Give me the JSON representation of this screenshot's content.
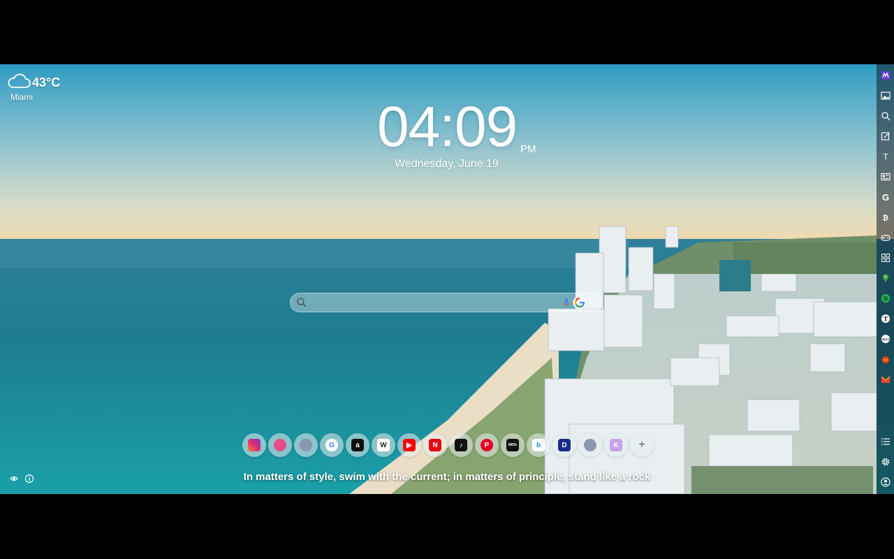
{
  "weather": {
    "temperature": "43°C",
    "city": "Miami",
    "icon": "cloud-icon"
  },
  "clock": {
    "time": "04:09",
    "ampm": "PM",
    "date": "Wednesday, June 19"
  },
  "search": {
    "placeholder": "",
    "engine_icon": "google-icon"
  },
  "quote": {
    "text": "In matters of style, swim with the current; in matters of principle, stand like a rock"
  },
  "dock": {
    "shortcuts": [
      {
        "name": "instagram",
        "label": "",
        "color": "#e1306c"
      },
      {
        "name": "dribbble",
        "label": "",
        "color": "#ea4c89"
      },
      {
        "name": "web",
        "label": "",
        "color": "#8a97b0"
      },
      {
        "name": "google",
        "label": "G",
        "color": "#4285f4"
      },
      {
        "name": "amazon",
        "label": "a",
        "color": "#111111"
      },
      {
        "name": "wikipedia",
        "label": "W",
        "color": "#ffffff"
      },
      {
        "name": "youtube",
        "label": "▶",
        "color": "#ff0000"
      },
      {
        "name": "netflix",
        "label": "N",
        "color": "#e50914"
      },
      {
        "name": "tiktok",
        "label": "♪",
        "color": "#111111"
      },
      {
        "name": "pinterest",
        "label": "P",
        "color": "#e60023"
      },
      {
        "name": "imdb",
        "label": "IMDb",
        "color": "#111111"
      },
      {
        "name": "bing",
        "label": "b",
        "color": "#0a8ee0"
      },
      {
        "name": "dashlane",
        "label": "D",
        "color": "#1b2a8a"
      },
      {
        "name": "web-2",
        "label": "",
        "color": "#8a97b0"
      },
      {
        "name": "klarna",
        "label": "K",
        "color": "#c9a3e8"
      },
      {
        "name": "add",
        "label": "+",
        "color": "#666666"
      }
    ]
  },
  "footer": {
    "icons": [
      "eye-icon",
      "info-icon"
    ]
  },
  "sidebar": {
    "items": [
      "app-logo-icon",
      "wallpaper-icon",
      "search-icon",
      "notes-icon",
      "text-icon",
      "news-icon",
      "google-icon",
      "bitcoin-icon",
      "games-icon",
      "apps-icon",
      "maps-icon",
      "spotify-icon",
      "nytimes-icon",
      "wsj-icon",
      "reddit-icon",
      "gmail-icon",
      "list-icon",
      "settings-icon",
      "account-icon"
    ]
  }
}
